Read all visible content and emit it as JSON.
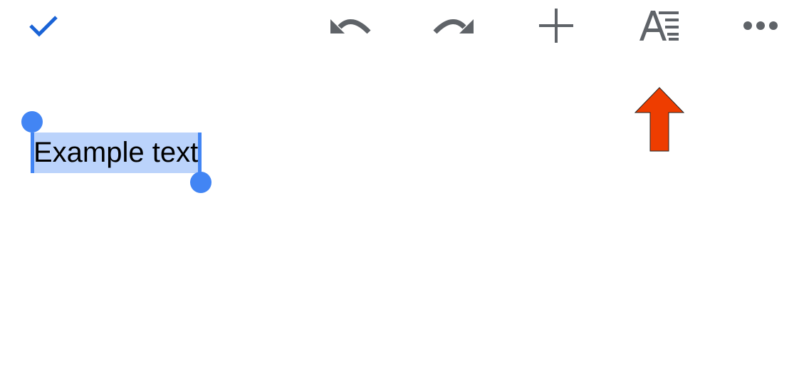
{
  "toolbar": {
    "icons": {
      "done": "check-icon",
      "undo": "undo-icon",
      "redo": "redo-icon",
      "insert": "plus-icon",
      "format": "text-format-icon",
      "more": "more-horizontal-icon"
    },
    "colors": {
      "accent": "#1a63d6",
      "icon": "#5f6368"
    }
  },
  "document": {
    "selected_text": "Example text"
  },
  "selection": {
    "highlight_color": "#bbd3fb",
    "handle_color": "#4285f4"
  },
  "annotation": {
    "icon": "up-arrow-icon",
    "color": "#ee3d00"
  }
}
